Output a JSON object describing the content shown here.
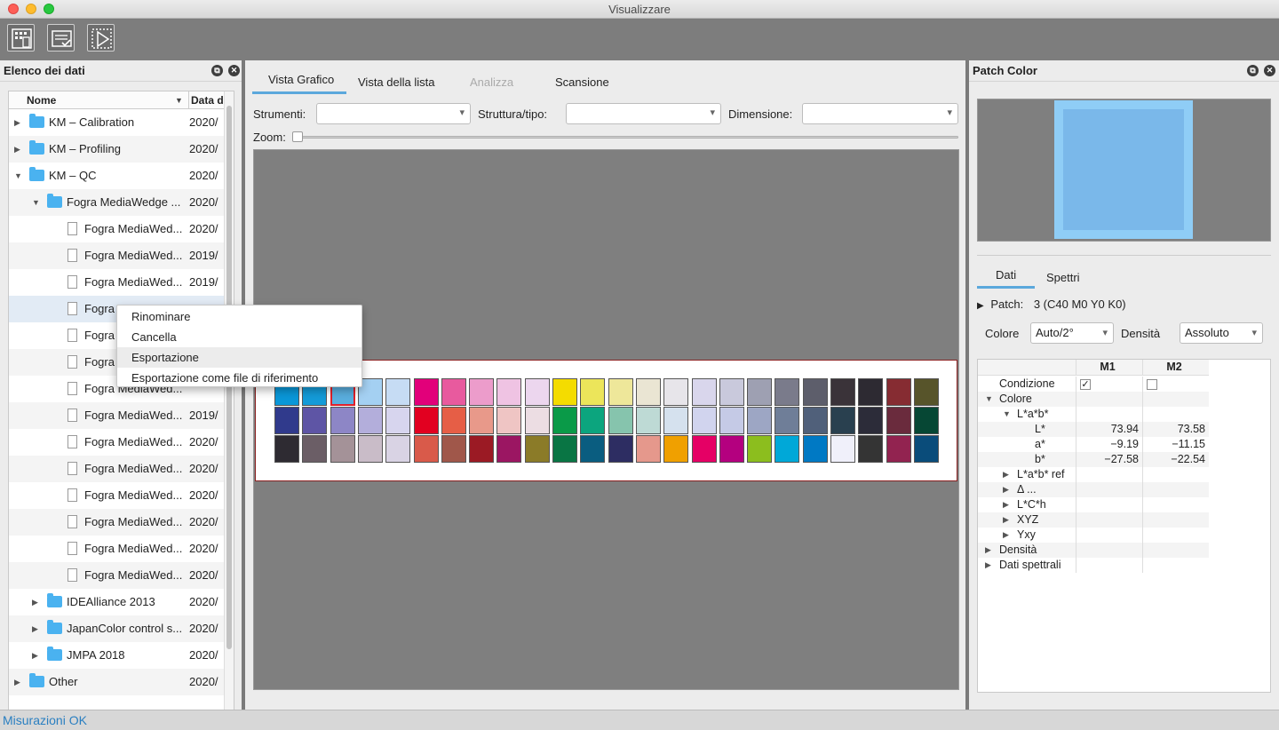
{
  "window": {
    "title": "Visualizzare"
  },
  "toolbar": {
    "icons": [
      "instrument-icon",
      "checklist-icon",
      "play-icon"
    ]
  },
  "left_panel": {
    "title": "Elenco dei dati",
    "columns": {
      "name": "Nome",
      "date": "Data d"
    },
    "rows": [
      {
        "label": "KM – Calibration",
        "date": "2020/",
        "type": "folder",
        "level": 0,
        "expand": "collapsed"
      },
      {
        "label": "KM – Profiling",
        "date": "2020/",
        "type": "folder",
        "level": 0,
        "expand": "collapsed"
      },
      {
        "label": "KM – QC",
        "date": "2020/",
        "type": "folder",
        "level": 0,
        "expand": "expanded"
      },
      {
        "label": "Fogra MediaWedge ...",
        "date": "2020/",
        "type": "folder",
        "level": 1,
        "expand": "expanded"
      },
      {
        "label": "Fogra MediaWed...",
        "date": "2020/",
        "type": "file",
        "level": 2
      },
      {
        "label": "Fogra MediaWed...",
        "date": "2019/",
        "type": "file",
        "level": 2
      },
      {
        "label": "Fogra MediaWed...",
        "date": "2019/",
        "type": "file",
        "level": 2
      },
      {
        "label": "Fogra",
        "date": "",
        "type": "file",
        "level": 2,
        "selected": true
      },
      {
        "label": "Fogra",
        "date": "",
        "type": "file",
        "level": 2
      },
      {
        "label": "Fogra",
        "date": "",
        "type": "file",
        "level": 2
      },
      {
        "label": "Fogra MediaWed...",
        "date": "",
        "type": "file",
        "level": 2
      },
      {
        "label": "Fogra MediaWed...",
        "date": "2019/",
        "type": "file",
        "level": 2
      },
      {
        "label": "Fogra MediaWed...",
        "date": "2020/",
        "type": "file",
        "level": 2
      },
      {
        "label": "Fogra MediaWed...",
        "date": "2020/",
        "type": "file",
        "level": 2
      },
      {
        "label": "Fogra MediaWed...",
        "date": "2020/",
        "type": "file",
        "level": 2
      },
      {
        "label": "Fogra MediaWed...",
        "date": "2020/",
        "type": "file",
        "level": 2
      },
      {
        "label": "Fogra MediaWed...",
        "date": "2020/",
        "type": "file",
        "level": 2
      },
      {
        "label": "Fogra MediaWed...",
        "date": "2020/",
        "type": "file",
        "level": 2
      },
      {
        "label": "IDEAlliance 2013",
        "date": "2020/",
        "type": "folder",
        "level": 1,
        "expand": "collapsed"
      },
      {
        "label": "JapanColor control s...",
        "date": "2020/",
        "type": "folder",
        "level": 1,
        "expand": "collapsed"
      },
      {
        "label": "JMPA 2018",
        "date": "2020/",
        "type": "folder",
        "level": 1,
        "expand": "collapsed"
      },
      {
        "label": "Other",
        "date": "2020/",
        "type": "folder",
        "level": 0,
        "expand": "collapsed"
      }
    ]
  },
  "context_menu": {
    "items": [
      "Rinominare",
      "Cancella",
      "Esportazione",
      "Esportazione come file di riferimento"
    ],
    "highlighted": 2
  },
  "center": {
    "tabs": [
      {
        "label": "Vista Grafico",
        "state": "active"
      },
      {
        "label": "Vista della lista",
        "state": "normal"
      },
      {
        "label": "Analizza",
        "state": "disabled"
      },
      {
        "label": "Scansione",
        "state": "normal"
      }
    ],
    "filters": {
      "strumenti": "Strumenti:",
      "struttura": "Struttura/tipo:",
      "dimensione": "Dimensione:",
      "zoom": "Zoom:"
    },
    "patches": [
      [
        "#0a97d8",
        "#149bd8",
        "#5aaede",
        "#a4d0f2",
        "#c6dcf4",
        "#e2007a",
        "#e85a9e",
        "#ec9ccb",
        "#efc3e3",
        "#ecd6ee",
        "#f4dc00",
        "#ece55a",
        "#eee79a",
        "#eae5d3",
        "#e7e5ea",
        "#d9d6ec",
        "#c9c9dc",
        "#9ea0b2",
        "#7a7b8b",
        "#5d5e6b",
        "#3a3339",
        "#2d2a32",
        "#862c32",
        "#57542a"
      ],
      [
        "#303a8c",
        "#5e55a5",
        "#8d86c6",
        "#b3aedb",
        "#d7d5ee",
        "#e20020",
        "#e65e46",
        "#e8998a",
        "#efc5c4",
        "#ecdde3",
        "#0a9a48",
        "#0ca57e",
        "#86c4ad",
        "#bedad5",
        "#d5e1ee",
        "#d1d4ee",
        "#c5cae6",
        "#9da6c4",
        "#6f7e98",
        "#50607a",
        "#29404f",
        "#2c2c39",
        "#6a2b3d",
        "#064734"
      ],
      [
        "#2e2b32",
        "#6b5e66",
        "#a49298",
        "#c9bcc8",
        "#d9d3e4",
        "#d95a4a",
        "#a0574a",
        "#9b1a24",
        "#9b1662",
        "#8b7b28",
        "#097544",
        "#0a5d80",
        "#2d2d62",
        "#e5988c",
        "#f0a000",
        "#e50065",
        "#b4007f",
        "#8cbe1e",
        "#00a8d8",
        "#0079c4",
        "#f0f0fa",
        "#343434",
        "#922350",
        "#0a4c7a"
      ]
    ]
  },
  "right_panel": {
    "title": "Patch Color",
    "preview_outer": "#8fcdf6",
    "preview_inner": "#7ab8ea",
    "tabs": [
      "Dati",
      "Spettri"
    ],
    "patch_label": "Patch:",
    "patch_value": "3 (C40 M0 Y0 K0)",
    "colore_label": "Colore",
    "colore_value": "Auto/2°",
    "densita_label": "Densità",
    "densita_value": "Assoluto",
    "table": {
      "headers": [
        "M1",
        "M2"
      ],
      "rows": [
        {
          "name": "Condizione",
          "m1": "✓",
          "m2": "",
          "kind": "check",
          "indent": 1
        },
        {
          "name": "Colore",
          "m1": "",
          "m2": "",
          "indent": 1,
          "expand": "expanded"
        },
        {
          "name": "L*a*b*",
          "m1": "",
          "m2": "",
          "indent": 2,
          "expand": "expanded"
        },
        {
          "name": "L*",
          "m1": "73.94",
          "m2": "73.58",
          "indent": 3
        },
        {
          "name": "a*",
          "m1": "−9.19",
          "m2": "−11.15",
          "indent": 3
        },
        {
          "name": "b*",
          "m1": "−27.58",
          "m2": "−22.54",
          "indent": 3
        },
        {
          "name": "L*a*b* ref",
          "m1": "",
          "m2": "",
          "indent": 2,
          "expand": "collapsed"
        },
        {
          "name": "Δ ...",
          "m1": "",
          "m2": "",
          "indent": 2,
          "expand": "collapsed"
        },
        {
          "name": "L*C*h",
          "m1": "",
          "m2": "",
          "indent": 2,
          "expand": "collapsed"
        },
        {
          "name": "XYZ",
          "m1": "",
          "m2": "",
          "indent": 2,
          "expand": "collapsed"
        },
        {
          "name": "Yxy",
          "m1": "",
          "m2": "",
          "indent": 2,
          "expand": "collapsed"
        },
        {
          "name": "Densità",
          "m1": "",
          "m2": "",
          "indent": 1,
          "expand": "collapsed"
        },
        {
          "name": "Dati spettrali",
          "m1": "",
          "m2": "",
          "indent": 1,
          "expand": "collapsed"
        }
      ]
    }
  },
  "status": {
    "text": "Misurazioni OK"
  }
}
